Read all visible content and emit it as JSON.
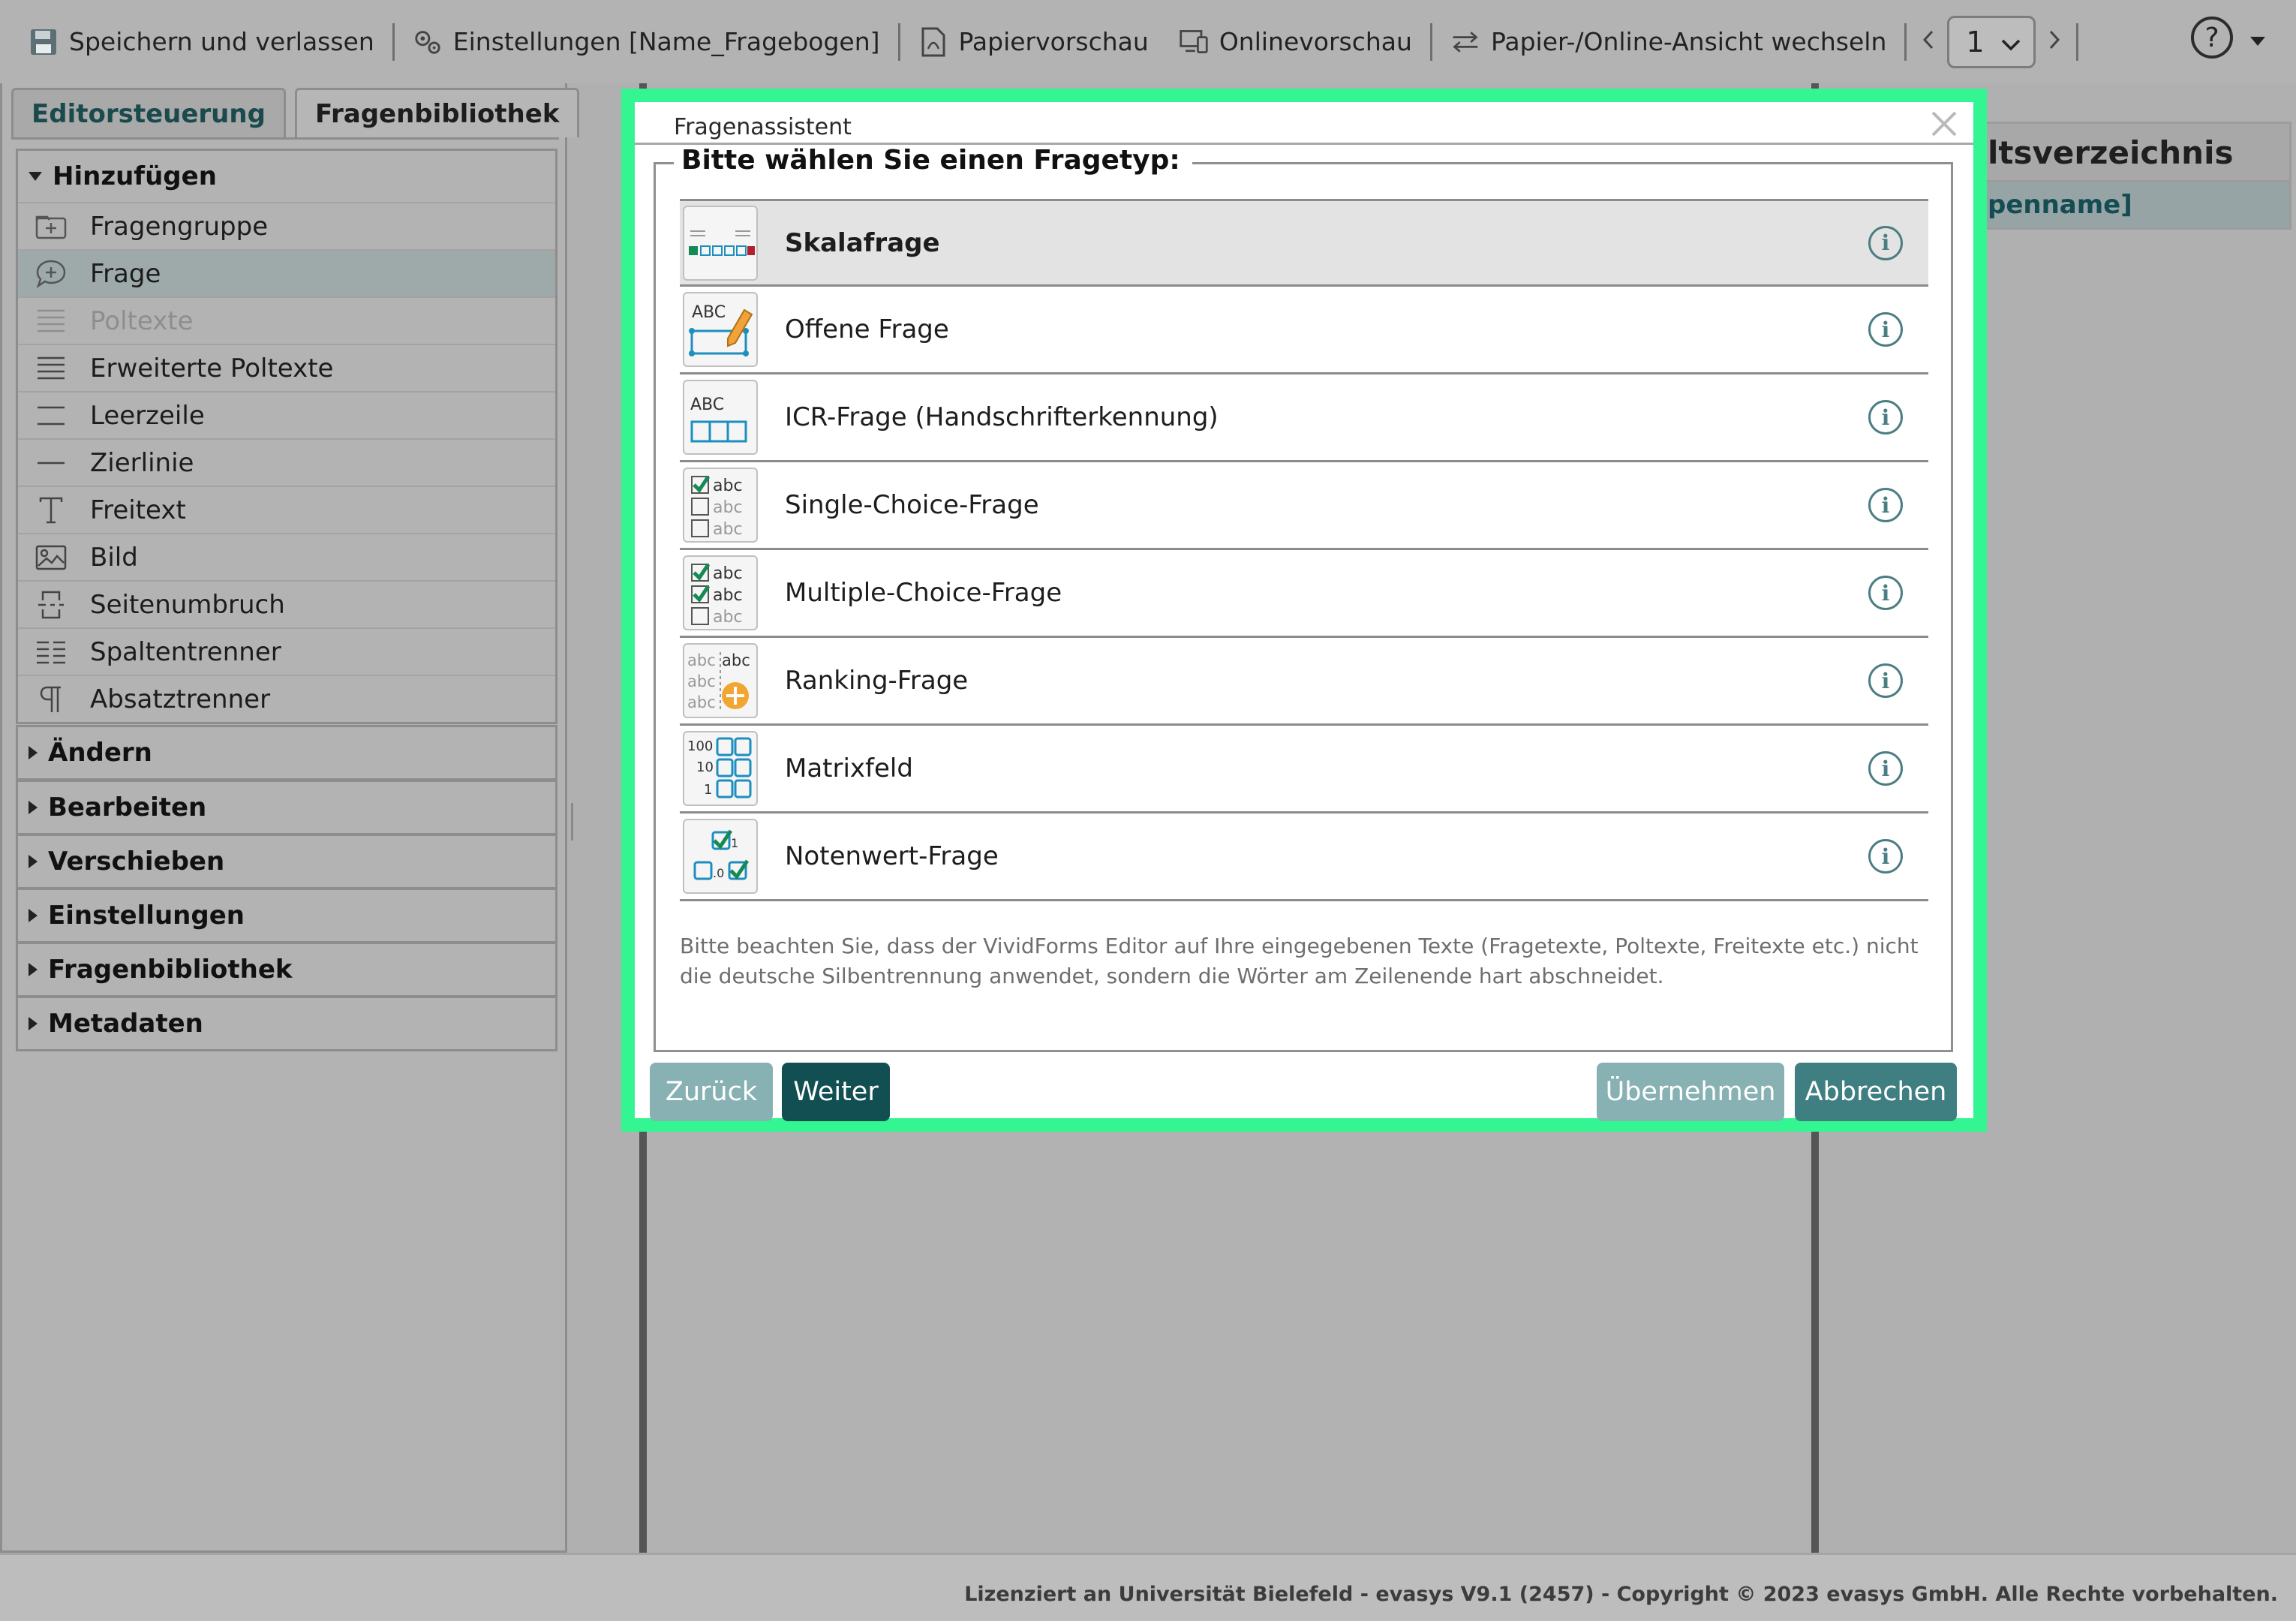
{
  "toolbar": {
    "save_label": "Speichern und verlassen",
    "settings_label": "Einstellungen [Name_Fragebogen]",
    "paper_preview_label": "Papiervorschau",
    "online_preview_label": "Onlinevorschau",
    "switch_view_label": "Papier-/Online-Ansicht wechseln",
    "page_number": "1",
    "help_label": "?"
  },
  "left_panel": {
    "tabs": [
      {
        "label": "Editorsteuerung",
        "active": true
      },
      {
        "label": "Fragenbibliothek",
        "active": false
      }
    ],
    "groups": [
      {
        "label": "Hinzufügen",
        "expanded": true,
        "items": [
          {
            "label": "Fragengruppe",
            "icon": "add-group-icon"
          },
          {
            "label": "Frage",
            "icon": "add-question-icon",
            "selected": true
          },
          {
            "label": "Poltexte",
            "icon": "pole-text-icon",
            "disabled": true
          },
          {
            "label": "Erweiterte Poltexte",
            "icon": "extended-pole-text-icon"
          },
          {
            "label": "Leerzeile",
            "icon": "empty-line-icon"
          },
          {
            "label": "Zierlinie",
            "icon": "decor-line-icon"
          },
          {
            "label": "Freitext",
            "icon": "free-text-icon"
          },
          {
            "label": "Bild",
            "icon": "image-icon"
          },
          {
            "label": "Seitenumbruch",
            "icon": "page-break-icon"
          },
          {
            "label": "Spaltentrenner",
            "icon": "column-separator-icon"
          },
          {
            "label": "Absatztrenner",
            "icon": "paragraph-icon"
          }
        ]
      },
      {
        "label": "Ändern",
        "expanded": false
      },
      {
        "label": "Bearbeiten",
        "expanded": false
      },
      {
        "label": "Verschieben",
        "expanded": false
      },
      {
        "label": "Einstellungen",
        "expanded": false
      },
      {
        "label": "Fragenbibliothek",
        "expanded": false
      },
      {
        "label": "Metadaten",
        "expanded": false
      }
    ]
  },
  "right_panel": {
    "title": "ltsverzeichnis",
    "row": "penname]"
  },
  "dialog": {
    "title": "Fragenassistent",
    "legend": "Bitte wählen Sie einen Fragetyp:",
    "question_types": [
      {
        "label": "Skalafrage",
        "icon": "scale-question-icon",
        "selected": true
      },
      {
        "label": "Offene Frage",
        "icon": "open-question-icon"
      },
      {
        "label": "ICR-Frage (Handschrifterkennung)",
        "icon": "icr-question-icon"
      },
      {
        "label": "Single-Choice-Frage",
        "icon": "single-choice-icon"
      },
      {
        "label": "Multiple-Choice-Frage",
        "icon": "multiple-choice-icon"
      },
      {
        "label": "Ranking-Frage",
        "icon": "ranking-icon"
      },
      {
        "label": "Matrixfeld",
        "icon": "matrix-field-icon"
      },
      {
        "label": "Notenwert-Frage",
        "icon": "grade-value-icon"
      }
    ],
    "note": "Bitte beachten Sie, dass der VividForms Editor auf Ihre eingegebenen Texte (Fragetexte, Poltexte, Freitexte etc.) nicht die deutsche Silbentrennung anwendet, sondern die Wörter am Zeilenende hart abschneidet.",
    "buttons": {
      "back": "Zurück",
      "next": "Weiter",
      "apply": "Übernehmen",
      "cancel": "Abbrechen"
    },
    "colors": {
      "highlight_border": "#33f591",
      "primary": "#124f52",
      "muted": "#87b1b2",
      "cancel": "#3f7f82",
      "info": "#4b7e82"
    }
  },
  "footer": {
    "text": "Lizenziert an Universität Bielefeld - evasys V9.1 (2457) - Copyright © 2023 evasys GmbH. Alle Rechte vorbehalten."
  }
}
